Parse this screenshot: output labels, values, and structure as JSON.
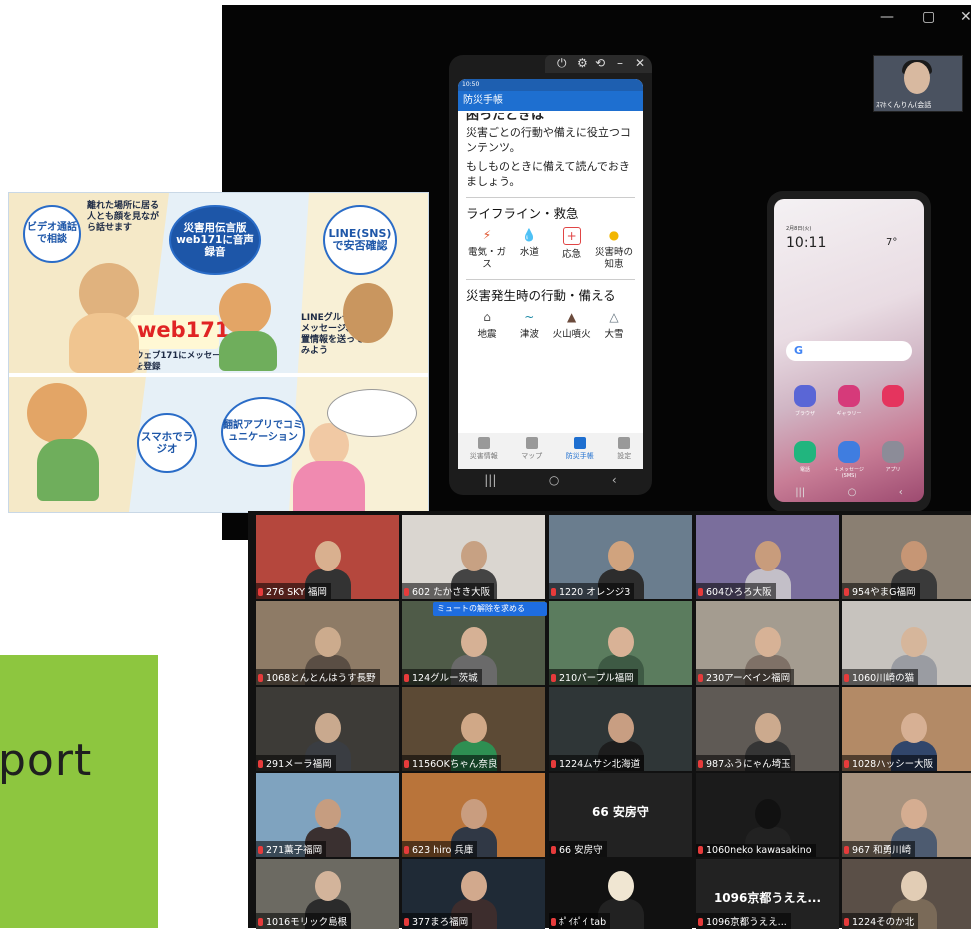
{
  "green_card": {
    "text": "port"
  },
  "window": {
    "controls": [
      "—",
      "▢",
      "✕"
    ],
    "self_view_name": "ｽﾏﾎくんりん(会話"
  },
  "phone1": {
    "topbar_controls": [
      "⏻",
      "⚙",
      "⟲",
      "–",
      "✕"
    ],
    "status": "10:50",
    "header": "防災手帳",
    "title_partial": "困ったときは",
    "intro": [
      "災害ごとの行動や備えに役立つコ",
      "ンテンツ。",
      "もしものときに備えて読んでおき",
      "ましょう。"
    ],
    "section1": "ライフライン・救急",
    "icons1": [
      "電気・ガス",
      "水道",
      "応急",
      "災害時の知恵"
    ],
    "section2": "災害発生時の行動・備える",
    "icons2": [
      "地震",
      "津波",
      "火山噴火",
      "大雪"
    ],
    "tabs": [
      "災害情報",
      "マップ",
      "防災手帳",
      "設定"
    ],
    "nav": [
      "|||",
      "○",
      "‹"
    ]
  },
  "phone2": {
    "date": "2月8日(火)",
    "time": "10:11",
    "temp": "7°",
    "search_g": "G",
    "apps_row1": [
      "ブラウザ",
      "ギャラリー",
      ""
    ],
    "apps_row2": [
      "電話",
      "＋メッセージ(SMS)",
      "アプリ"
    ],
    "nav": [
      "|||",
      "○",
      "‹"
    ]
  },
  "poster": {
    "bubble_video": "ビデオ通話で相談",
    "remote_text": "離れた場所に居る人とも顔を見ながら話せます",
    "bubble_web171": "災害用伝言版web171に音声録音",
    "bubble_line": "LINE(SNS)で安否確認",
    "web171_logo": "web171",
    "web171_caption": "ウェブ171にメッセージを登録",
    "line_text": "LINEグループにメッセージ、位置情報を送ってみよう",
    "bubble_radio": "スマホでラジオ",
    "bubble_translate": "翻訳アプリでコミュニケーション"
  },
  "grid": {
    "mute_popup": "ミュートの解除を求める",
    "tiles": [
      {
        "name": "276 SKY 福岡",
        "bg": "#b5473d",
        "head": "#d9b08f",
        "body": "#333"
      },
      {
        "name": "602 たかさき大阪",
        "bg": "#dad6d0",
        "head": "#c7a183",
        "body": "#444"
      },
      {
        "name": "1220 オレンジ3",
        "bg": "#6a7d8e",
        "head": "#d0a37e",
        "body": "#2d2d2d"
      },
      {
        "name": "604ひろろ大阪",
        "bg": "#7a6e9c",
        "head": "#c89c7c",
        "body": "#c3bfc8"
      },
      {
        "name": "954やまG福岡",
        "bg": "#8a7f72",
        "head": "#c69675",
        "body": "#3a3a3a"
      },
      {
        "name": "1068とんとんはうす長野",
        "bg": "#8e7b66",
        "head": "#ccab8d",
        "body": "#5a4e44"
      },
      {
        "name": "124グルー茨城",
        "bg": "#4f5b48",
        "head": "#d6b195",
        "body": "#6a6a6a"
      },
      {
        "name": "210パープル福岡",
        "bg": "#5b7c5e",
        "head": "#d9b296",
        "body": "#3e5a44"
      },
      {
        "name": "230アーベイン福岡",
        "bg": "#a49c90",
        "head": "#d7b296",
        "body": "#7f7167"
      },
      {
        "name": "1060川崎の猫",
        "bg": "#c7c3be",
        "head": "#d6b69b",
        "body": "#9a9ca2"
      },
      {
        "name": "291メーラ福岡",
        "bg": "#3d3b37",
        "head": "#c9a98e",
        "body": "#3a3d42"
      },
      {
        "name": "1156OKちゃん奈良",
        "bg": "#5c4a35",
        "head": "#d0a887",
        "body": "#2e8f52"
      },
      {
        "name": "1224ムサシ北海道",
        "bg": "#2f3637",
        "head": "#c89e82",
        "body": "#1d1d1d"
      },
      {
        "name": "987ふうにゃん埼玉",
        "bg": "#5f5a55",
        "head": "#ccaa8e",
        "body": "#353535"
      },
      {
        "name": "1028ハッシー大阪",
        "bg": "#b38a66",
        "head": "#d7b094",
        "body": "#31466b"
      },
      {
        "name": "271薫子福岡",
        "bg": "#7fa3bf",
        "head": "#c69d80",
        "body": "#3a3030"
      },
      {
        "name": "623 hiro 兵庫",
        "bg": "#b9743a",
        "head": "#c99d7f",
        "body": "#303845"
      },
      {
        "name": "66 安房守",
        "bg": "#222",
        "bigname": "66 安房守",
        "head": "",
        "body": ""
      },
      {
        "name": "1060neko kawasakino",
        "bg": "#1b1b1b",
        "head": "#111",
        "body": "#222"
      },
      {
        "name": "967 和勇川崎",
        "bg": "#a7927e",
        "head": "#d5ad91",
        "body": "#4d5b70"
      },
      {
        "name": "1016モリック島根",
        "bg": "#6c6a62",
        "head": "#d3b49b",
        "body": "#2b2b2b"
      },
      {
        "name": "377まろ福岡",
        "bg": "#1f2a36",
        "head": "#d2a98d",
        "body": "#3d2d2d"
      },
      {
        "name": "ﾎﾟｲﾎﾟｲ tab",
        "bg": "#111",
        "head": "#f0e6d2",
        "body": "#222"
      },
      {
        "name": "1096京都うええ...",
        "bg": "#222",
        "bigname": "1096京都うええ...",
        "head": "",
        "body": ""
      },
      {
        "name": "1224そのか北",
        "bg": "#5a4f47",
        "head": "#e2cdb5",
        "body": "#7a6a58"
      }
    ]
  }
}
